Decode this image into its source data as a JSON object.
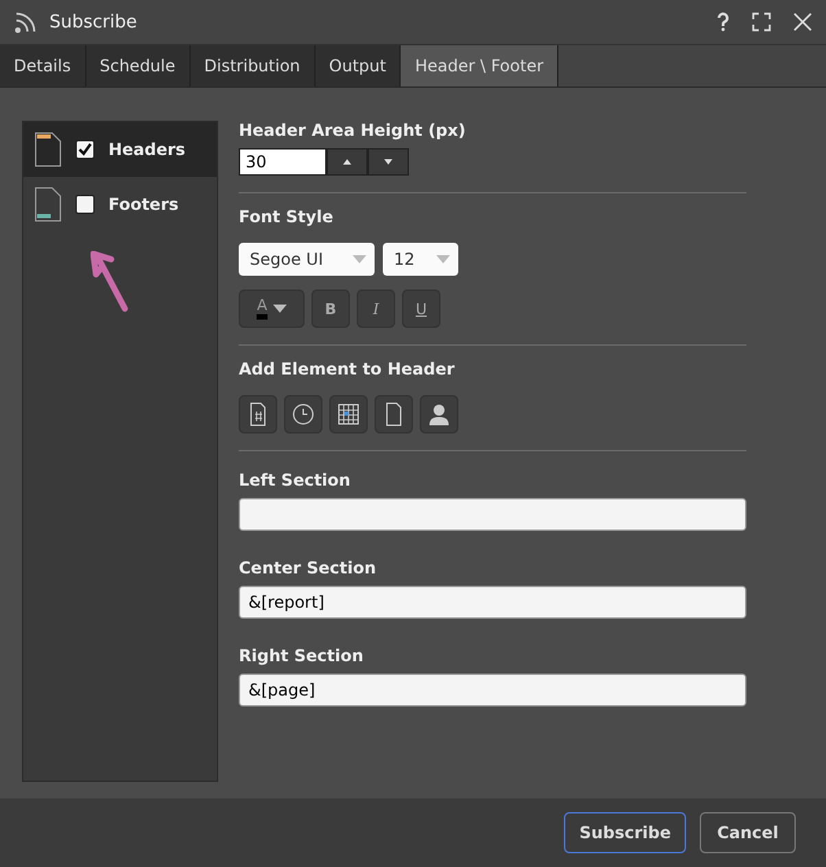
{
  "window": {
    "title": "Subscribe"
  },
  "tabs": [
    {
      "label": "Details",
      "selected": false
    },
    {
      "label": "Schedule",
      "selected": false
    },
    {
      "label": "Distribution",
      "selected": false
    },
    {
      "label": "Output",
      "selected": false
    },
    {
      "label": "Header \\ Footer",
      "selected": true
    }
  ],
  "sections": [
    {
      "label": "Headers",
      "checked": true,
      "selected": true,
      "kind": "header"
    },
    {
      "label": "Footers",
      "checked": false,
      "selected": false,
      "kind": "footer"
    }
  ],
  "form": {
    "height_label": "Header Area Height (px)",
    "height_value": "30",
    "font_style_label": "Font Style",
    "font": "Segoe UI",
    "size": "12",
    "color_letter": "A",
    "bold": "B",
    "italic": "I",
    "underline": "U",
    "add_element_label": "Add Element to Header",
    "elements": [
      {
        "kind": "page-number"
      },
      {
        "kind": "time"
      },
      {
        "kind": "date"
      },
      {
        "kind": "page"
      },
      {
        "kind": "user"
      }
    ],
    "fields": [
      {
        "label": "Left Section"
      },
      {
        "label": "Center Section",
        "value": "&[report]"
      },
      {
        "label": "Right Section",
        "value": "&[page]"
      }
    ]
  },
  "buttons": [
    {
      "label": "Subscribe",
      "kind": "primary"
    },
    {
      "label": "Cancel",
      "kind": "secondary"
    }
  ]
}
